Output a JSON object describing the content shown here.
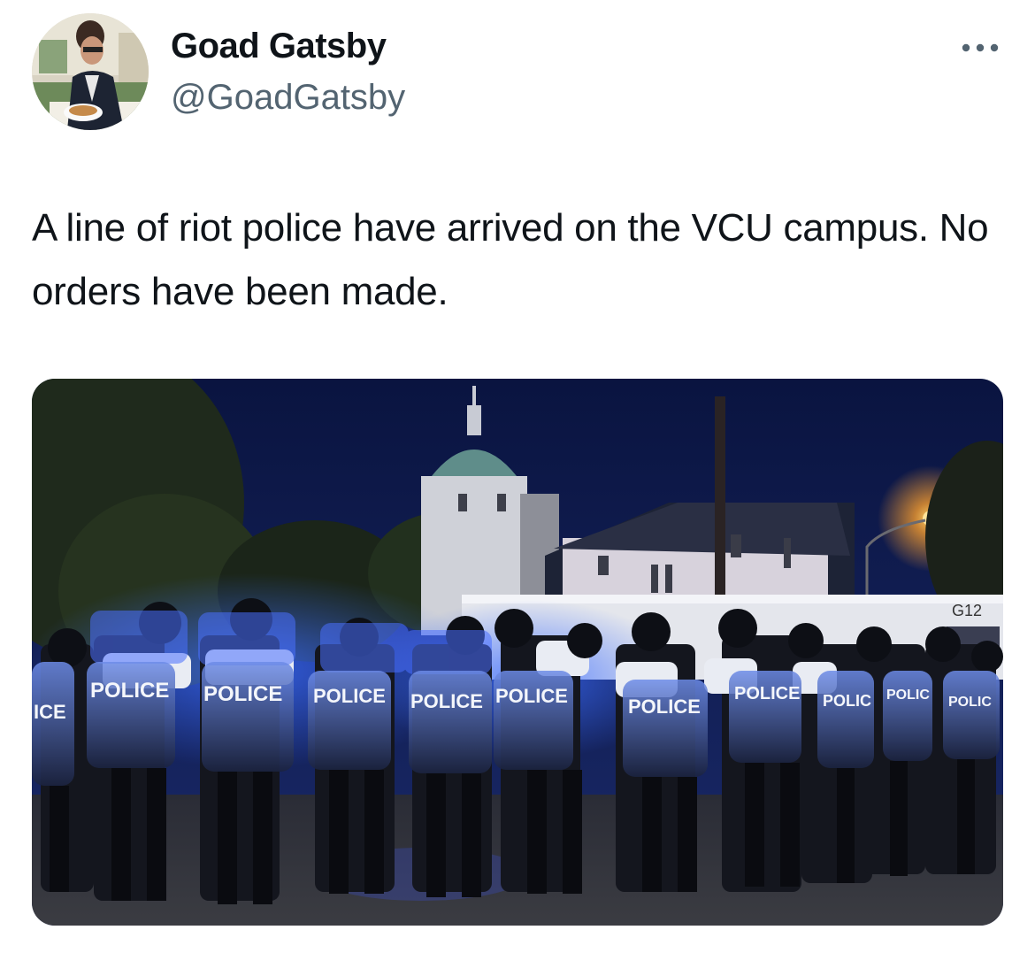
{
  "tweet": {
    "author": {
      "display_name": "Goad Gatsby",
      "handle": "@GoadGatsby"
    },
    "more_icon": "more-horizontal-icon",
    "text": "A line of riot police have arrived on the VCU campus. No orders have been made.",
    "media": {
      "shield_labels": [
        "ICE",
        "POLICE",
        "POLICE",
        "POLICE",
        "POLICE",
        "POLICE",
        "POLICE",
        "POLICE",
        "POLIC",
        "POLIC",
        "POLIC"
      ],
      "bus_number": "G12"
    }
  },
  "colors": {
    "text_primary": "#0f1419",
    "text_secondary": "#536471",
    "night_sky": "#0e1a4a",
    "police_blue_light": "#2a5cff"
  }
}
